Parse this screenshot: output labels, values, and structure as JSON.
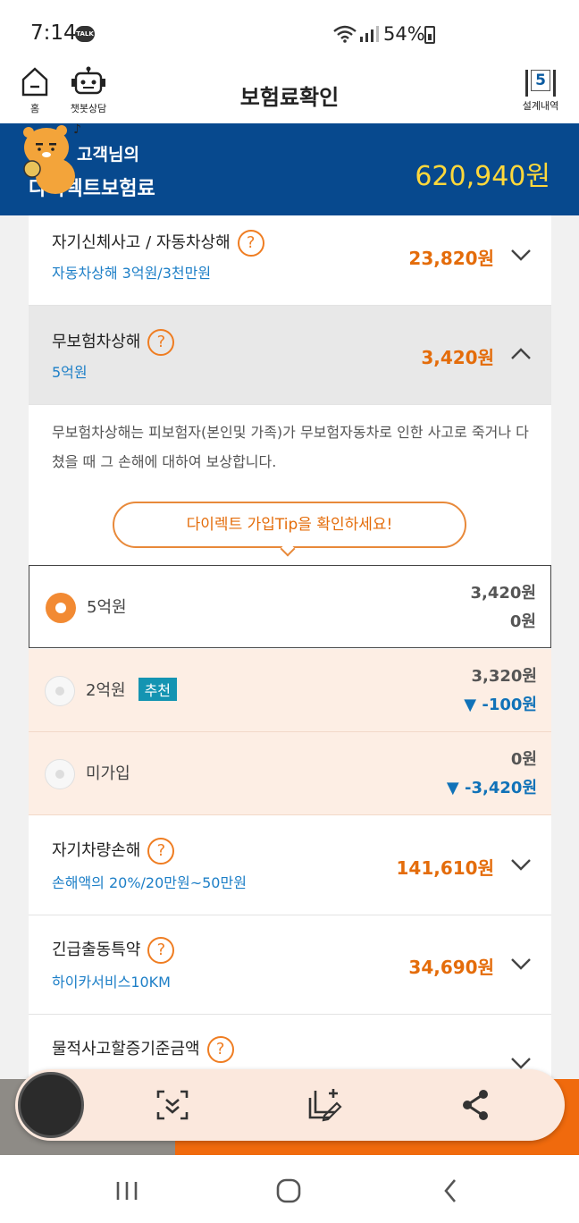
{
  "status": {
    "time": "7:14",
    "talk_badge": "TALK",
    "battery": "54%"
  },
  "appbar": {
    "home_label": "홈",
    "chat_label": "챗봇상담",
    "title": "보험료확인",
    "design_label": "설계내역",
    "design_count": "5"
  },
  "banner": {
    "line1": "고객님의",
    "line2": "다이렉트보험료",
    "amount": "620,940원"
  },
  "coverages": [
    {
      "title": "자기신체사고 / 자동차상해",
      "sub": "자동차상해    3억원/3천만원",
      "price": "23,820원",
      "expanded": false
    },
    {
      "title": "무보험차상해",
      "sub": "5억원",
      "price": "3,420원",
      "expanded": true
    },
    {
      "title": "자기차량손해",
      "sub": "손해액의 20%/20만원~50만원",
      "price": "141,610원",
      "expanded": false
    },
    {
      "title": "긴급출동특약",
      "sub": "하이카서비스10KM",
      "price": "34,690원",
      "expanded": false
    },
    {
      "title": "물적사고할증기준금액",
      "sub": "",
      "price": "",
      "expanded": false
    }
  ],
  "detail": {
    "description": "무보험차상해는 피보험자(본인및 가족)가 무보험자동차로 인한 사고로 죽거나 다쳤을 때 그 손해에 대하여 보상합니다.",
    "tip_button": "다이렉트 가입Tip을 확인하세요!"
  },
  "options": [
    {
      "label": "5억원",
      "price": "3,420원",
      "diff": "0원",
      "selected": true,
      "badge": ""
    },
    {
      "label": "2억원",
      "price": "3,320원",
      "diff": "▼ -100원",
      "selected": false,
      "badge": "추천"
    },
    {
      "label": "미가입",
      "price": "0원",
      "diff": "▼ -3,420원",
      "selected": false,
      "badge": ""
    }
  ],
  "colors": {
    "brand_blue": "#07498e",
    "accent_orange": "#e46c0a",
    "amount_yellow": "#ffd83b",
    "link_blue": "#1d7fc7"
  },
  "icons": [
    "home-icon",
    "chatbot-icon",
    "help-icon",
    "chevron-down-icon",
    "chevron-up-icon",
    "scroll-capture-icon",
    "edit-icon",
    "share-icon",
    "recent-apps-icon",
    "home-circle-icon",
    "back-icon"
  ]
}
